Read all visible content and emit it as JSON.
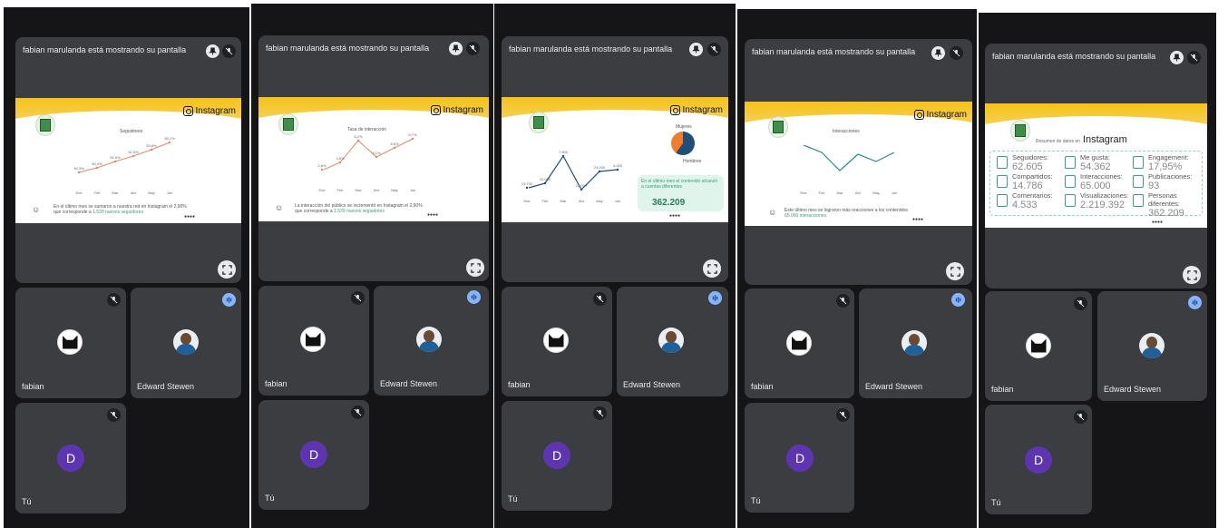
{
  "share_title": "fabian marulanda está mostrando su pantalla",
  "instagram_label": "Instagram",
  "participants": {
    "fabian": "fabian",
    "edward": "Edward Stewen",
    "you": "Tú",
    "you_initial": "D"
  },
  "panel1": {
    "caption_1": "En el último mes se sumaron a nuestra red en Instagram el 2,90%",
    "caption_2a": "que corresponde a",
    "caption_2b": "1.539 nuevos seguidores",
    "chart_title": "Seguidores",
    "x_labels": [
      "Ene",
      "Feb",
      "Mar",
      "Abr",
      "May",
      "Jun"
    ],
    "points": [
      "49,3%",
      "50,4%",
      "51,6%",
      "52,5%",
      "53,8%",
      "55,1%"
    ]
  },
  "panel2": {
    "chart_title": "Tasa de interacción",
    "caption_1": "La interacción del público se incrementó en Instagram el 2,90%",
    "caption_2a": "que corresponde a",
    "caption_2b": "1.539 nuevos seguidores",
    "x_labels": [
      "Ene",
      "Feb",
      "Mar",
      "Abr",
      "May",
      "Jun"
    ],
    "points": [
      "2,6%",
      "3,5%",
      "6,2%",
      "4,1%",
      "5,6%",
      "6,7%"
    ]
  },
  "panel3": {
    "chart_values": [
      "13.700",
      "43.000",
      "7.500",
      "22.000",
      "24.000",
      "4.000"
    ],
    "x_labels": [
      "Ene",
      "Feb",
      "Mar",
      "Abr",
      "May",
      "Jun"
    ],
    "pie_labels": [
      "Mujeres",
      "Hombres"
    ],
    "box_text": "En el último mes el contenido alcanzó a cuentas diferentes",
    "box_value": "362.209"
  },
  "panel4": {
    "chart_title": "Interacciones",
    "caption_1": "Este último mes se lograron más reacciones a los contenidos",
    "caption_2": "65.000 interacciones",
    "x_labels": [
      "Ene",
      "Feb",
      "Mar",
      "Abr",
      "May",
      "Jun"
    ]
  },
  "panel5": {
    "summary_prefix": "Resumen de datos en",
    "summary_brand": "Instagram",
    "stats": [
      {
        "label": "Seguidores:",
        "value": "62.605"
      },
      {
        "label": "Me gusta:",
        "value": "54.362"
      },
      {
        "label": "Engagement:",
        "value": "17,95%"
      },
      {
        "label": "Compartidos:",
        "value": "14.786"
      },
      {
        "label": "Interacciones:",
        "value": "65.000"
      },
      {
        "label": "Publicaciones:",
        "value": "93"
      },
      {
        "label": "Comentarios:",
        "value": "4.533"
      },
      {
        "label": "Visualizaciones:",
        "value": "2.219.392"
      },
      {
        "label": "Personas diferentes:",
        "value": "362.209"
      }
    ]
  },
  "colors": {
    "dark_bg": "#151517",
    "tile_bg": "#3c3d40",
    "brand_yellow": "#f6c219",
    "avatar_purple": "#5e35b1",
    "speaking_blue": "#8ab4f8"
  }
}
